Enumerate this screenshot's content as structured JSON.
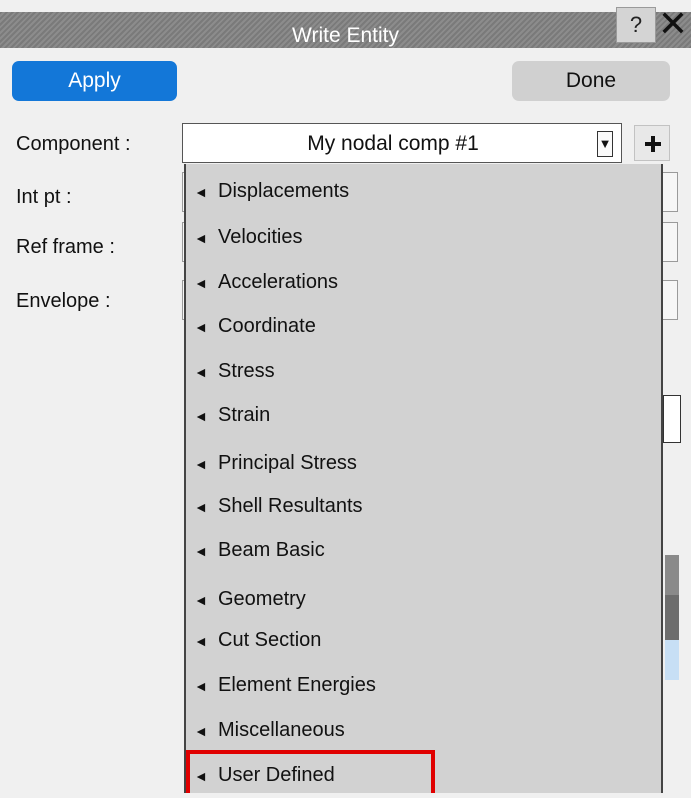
{
  "window": {
    "title": "Write Entity",
    "help_label": "?",
    "close_label": "✕"
  },
  "buttons": {
    "apply": "Apply",
    "done": "Done"
  },
  "labels": {
    "component": "Component :",
    "int_pt": "Int pt :",
    "ref_frame": "Ref frame :",
    "envelope": "Envelope :"
  },
  "component": {
    "value": "My nodal comp #1",
    "arrow": "▼"
  },
  "menu": {
    "arrow_glyph": "◄",
    "items": [
      "Displacements",
      "Velocities",
      "Accelerations",
      "Coordinate",
      "Stress",
      "Strain",
      "Principal Stress",
      "Shell Resultants",
      "Beam Basic",
      "Geometry",
      "Cut Section",
      "Element Energies",
      "Miscellaneous",
      "User Defined"
    ],
    "highlighted_item": "User Defined"
  },
  "colors": {
    "accent": "#1377d8",
    "highlight_border": "#e00000",
    "menu_bg": "#d2d2d2"
  }
}
